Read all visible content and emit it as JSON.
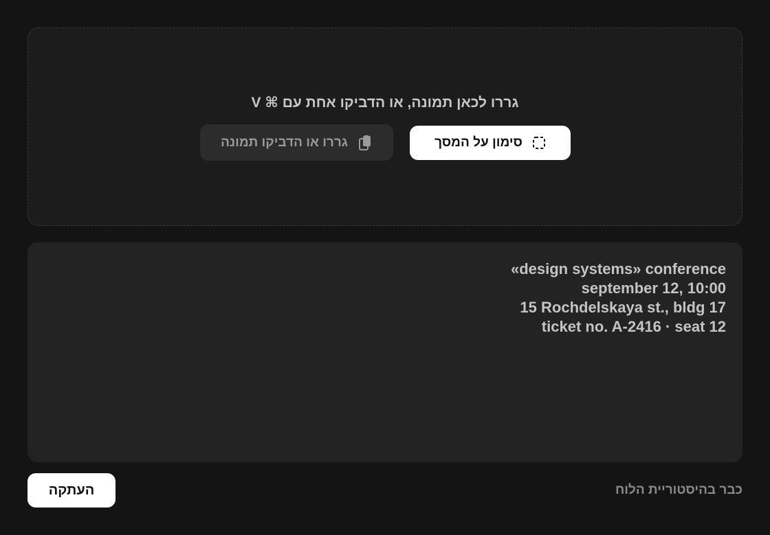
{
  "dropzone": {
    "hint": "גררו לכאן תמונה, או הדביקו אחת עם ⌘ V",
    "select_on_screen_label": "סימון על המסך",
    "drag_or_paste_label": "גררו או הדביקו תמונה",
    "select_icon": "dashed-selection-icon",
    "paste_icon": "clipboard-icon"
  },
  "result": {
    "lines": [
      "«design systems» conference",
      "september 12, 10:00",
      "15 Rochdelskaya st., bldg 17",
      "ticket no. A-2416 · seat 12"
    ]
  },
  "footer": {
    "status": "כבר בהיסטוריית הלוח",
    "copy_label": "העתקה"
  },
  "colors": {
    "background": "#141414",
    "panel": "#232323",
    "dropzone": "#1c1c1c",
    "primary_button": "#ffffff",
    "secondary_button": "#2c2c2c"
  }
}
